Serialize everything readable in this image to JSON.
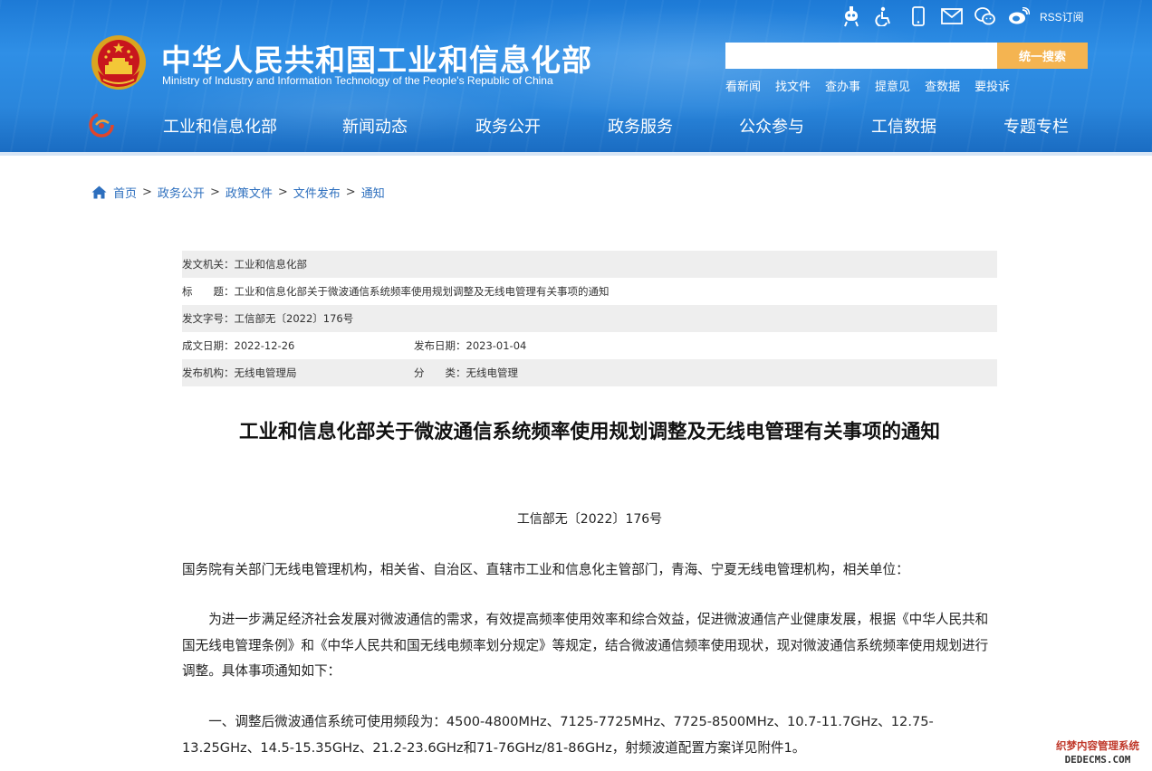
{
  "header": {
    "title_cn": "中华人民共和国工业和信息化部",
    "title_en": "Ministry of Industry and Information Technology of the People's Republic of China",
    "rss_label": "RSS订阅",
    "icons": [
      "robot-assistant-icon",
      "accessibility-icon",
      "mobile-icon",
      "mail-icon",
      "wechat-icon",
      "weibo-icon"
    ]
  },
  "search": {
    "value": "",
    "button_label": "统一搜索"
  },
  "quick_links": [
    "看新闻",
    "找文件",
    "查办事",
    "提意见",
    "查数据",
    "要投诉"
  ],
  "nav": [
    "工业和信息化部",
    "新闻动态",
    "政务公开",
    "政务服务",
    "公众参与",
    "工信数据",
    "专题专栏"
  ],
  "breadcrumb": [
    "首页",
    "政务公开",
    "政策文件",
    "文件发布",
    "通知"
  ],
  "meta": {
    "issuer_label": "发文机关：",
    "issuer": "工业和信息化部",
    "title_label": "标　　题：",
    "title": "工业和信息化部关于微波通信系统频率使用规划调整及无线电管理有关事项的通知",
    "doc_no_label": "发文字号：",
    "doc_no": "工信部无〔2022〕176号",
    "created_label": "成文日期：",
    "created": "2022-12-26",
    "published_label": "发布日期：",
    "published": "2023-01-04",
    "agency_label": "发布机构：",
    "agency": "无线电管理局",
    "category_label": "分　　类：",
    "category": "无线电管理"
  },
  "article": {
    "title": "工业和信息化部关于微波通信系统频率使用规划调整及无线电管理有关事项的通知",
    "doc_number": "工信部无〔2022〕176号",
    "addressee": "国务院有关部门无线电管理机构，相关省、自治区、直辖市工业和信息化主管部门，青海、宁夏无线电管理机构，相关单位：",
    "para1": "为进一步满足经济社会发展对微波通信的需求，有效提高频率使用效率和综合效益，促进微波通信产业健康发展，根据《中华人民共和国无线电管理条例》和《中华人民共和国无线电频率划分规定》等规定，结合微波通信频率使用现状，现对微波通信系统频率使用规划进行调整。具体事项通知如下：",
    "para2": "一、调整后微波通信系统可使用频段为：4500-4800MHz、7125-7725MHz、7725-8500MHz、10.7-11.7GHz、12.75-13.25GHz、14.5-15.35GHz、21.2-23.6GHz和71-76GHz/81-86GHz，射频波道配置方案详见附件1。"
  },
  "watermark": {
    "line1": "织梦内容管理系统",
    "line2": "DEDECMS.COM"
  },
  "colors": {
    "header_blue": "#2a86dc",
    "search_button": "#f4b451",
    "breadcrumb_link": "#2d6fbe",
    "meta_shade": "#eeeeee"
  }
}
